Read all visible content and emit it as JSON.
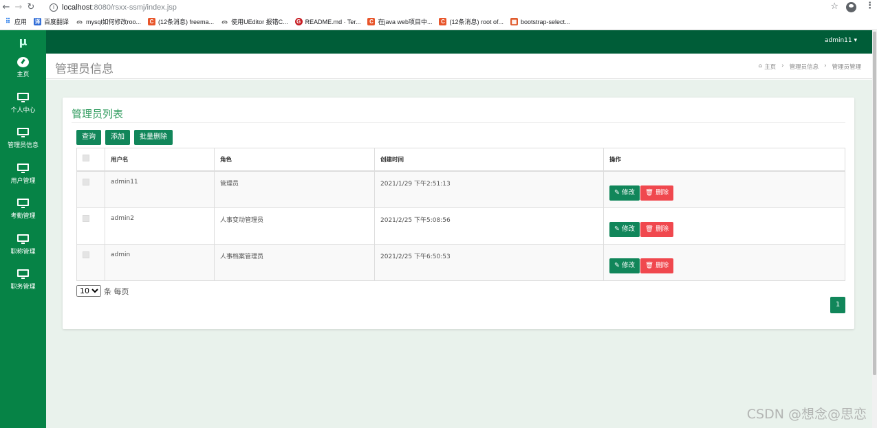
{
  "browser": {
    "url_host": "localhost",
    "url_path": ":8080/rsxx-ssmj/index.jsp",
    "bookmarks": [
      {
        "label": "应用",
        "icon": "apps-grid-icon",
        "color": "#1a73e8"
      },
      {
        "label": "百度翻译",
        "icon": "baidu-translate-icon",
        "color": "#2e6bd6"
      },
      {
        "label": "mysql如何修改roo...",
        "icon": "mysql-icon",
        "color": "#ffffff"
      },
      {
        "label": "(12条消息) freema...",
        "icon": "csdn-icon",
        "color": "#e8552a"
      },
      {
        "label": "使用UEditor 报错C...",
        "icon": "mysql-icon",
        "color": "#ffffff"
      },
      {
        "label": "README.md · Ter...",
        "icon": "gitee-icon",
        "color": "#c71d23"
      },
      {
        "label": "在java web项目中...",
        "icon": "csdn-icon",
        "color": "#e8552a"
      },
      {
        "label": "(12条消息) root of...",
        "icon": "csdn-icon",
        "color": "#e8552a"
      },
      {
        "label": "bootstrap-select...",
        "icon": "bookmark-icon",
        "color": "#e05a2b"
      }
    ]
  },
  "app": {
    "logo": "μ",
    "user": "admin11 ▾",
    "sidebar": [
      {
        "label": "主页",
        "icon": "dashboard-icon"
      },
      {
        "label": "个人中心",
        "icon": "monitor-icon"
      },
      {
        "label": "管理员信息",
        "icon": "monitor-icon"
      },
      {
        "label": "用户管理",
        "icon": "monitor-icon"
      },
      {
        "label": "考勤管理",
        "icon": "monitor-icon"
      },
      {
        "label": "职称管理",
        "icon": "monitor-icon"
      },
      {
        "label": "职务管理",
        "icon": "monitor-icon"
      }
    ],
    "page_title": "管理员信息",
    "breadcrumb": [
      "主页",
      "管理员信息",
      "管理员管理"
    ]
  },
  "panel": {
    "title": "管理员列表",
    "buttons": {
      "query": "查询",
      "add": "添加",
      "batch_delete": "批量删除"
    },
    "columns": [
      "用户名",
      "角色",
      "创建时间",
      "操作"
    ],
    "rows": [
      {
        "username": "admin11",
        "role": "管理员",
        "created": "2021/1/29 下午2:51:13"
      },
      {
        "username": "admin2",
        "role": "人事变动管理员",
        "created": "2021/2/25 下午5:08:56"
      },
      {
        "username": "admin",
        "role": "人事档案管理员",
        "created": "2021/2/25 下午6:50:53"
      }
    ],
    "row_actions": {
      "edit": "修改",
      "delete": "删除"
    },
    "page_size": "10",
    "per_page_label": "条 每页",
    "current_page": "1"
  },
  "watermark": "CSDN @想念@思恋",
  "colors": {
    "primary": "#068346",
    "topbar": "#005d38",
    "danger": "#f0484e",
    "content_bg": "#e9f2ec"
  }
}
